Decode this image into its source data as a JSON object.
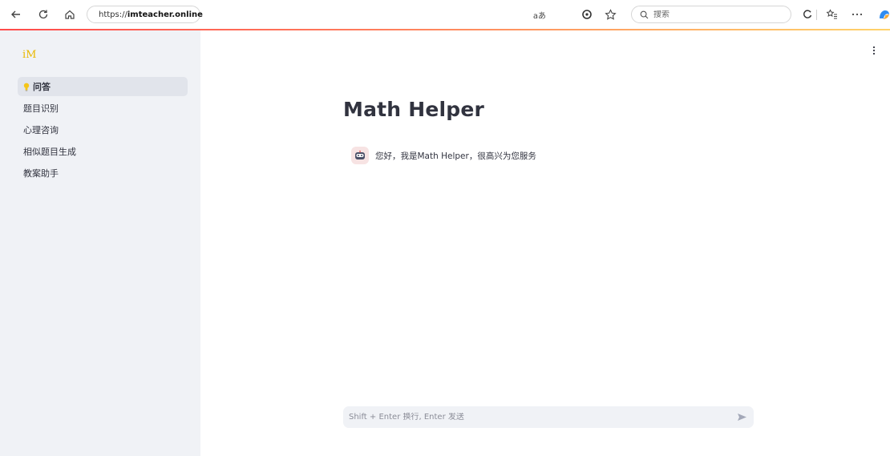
{
  "browser": {
    "url_prefix": "https://",
    "url_domain": "imteacher.online",
    "search_placeholder": "搜索",
    "reader_label": "aあ"
  },
  "sidebar": {
    "logo": "iM",
    "items": [
      {
        "label": "问答",
        "active": true,
        "icon": "lightbulb-icon"
      },
      {
        "label": "题目识别",
        "active": false
      },
      {
        "label": "心理咨询",
        "active": false
      },
      {
        "label": "相似题目生成",
        "active": false
      },
      {
        "label": "教案助手",
        "active": false
      }
    ]
  },
  "main": {
    "title": "Math Helper",
    "messages": [
      {
        "role": "assistant",
        "avatar": "robot-avatar-icon",
        "text": "您好，我是Math Helper，很高兴为您服务"
      }
    ]
  },
  "chat_input": {
    "placeholder": "Shift + Enter 换行, Enter 发送",
    "value": ""
  },
  "colors": {
    "sidebar_bg": "#f0f2f6",
    "active_item_bg": "#e1e4eb",
    "logo": "#e8b800",
    "text": "#31333f",
    "accent_line": "#ff4b4b"
  }
}
